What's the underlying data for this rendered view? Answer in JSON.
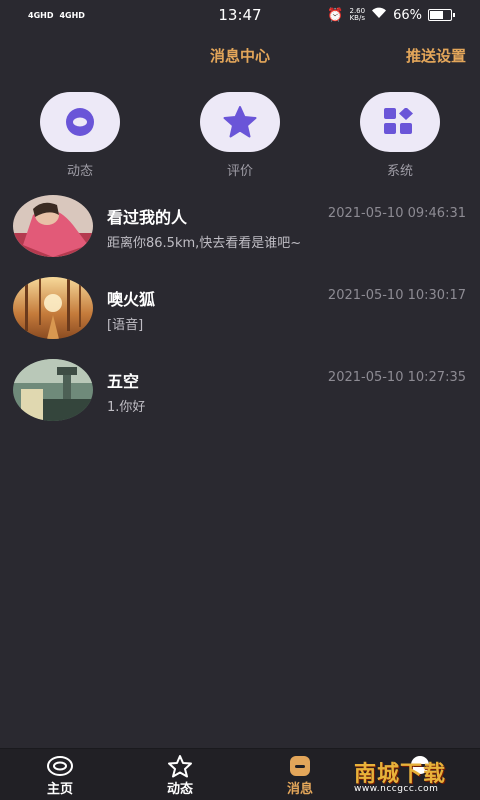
{
  "status_bar": {
    "network_1": "4GHD",
    "network_2": "4GHD",
    "time": "13:47",
    "speed_value": "2.60",
    "speed_unit": "KB/s",
    "battery": "66%",
    "battery_level": 0.66
  },
  "header": {
    "title": "消息中心",
    "action_label": "推送设置"
  },
  "categories": [
    {
      "label": "动态",
      "icon": "record-icon"
    },
    {
      "label": "评价",
      "icon": "star-icon"
    },
    {
      "label": "系统",
      "icon": "apps-icon"
    }
  ],
  "messages": [
    {
      "name": "看过我的人",
      "time": "2021-05-10 09:46:31",
      "preview": "距离你86.5km,快去看看是谁吧~"
    },
    {
      "name": "噢火狐",
      "time": "2021-05-10 10:30:17",
      "preview": "[语音]"
    },
    {
      "name": "五空",
      "time": "2021-05-10 10:27:35",
      "preview": "1.你好"
    }
  ],
  "bottom_nav": [
    {
      "label": "主页",
      "icon": "home-ring-icon"
    },
    {
      "label": "动态",
      "icon": "star-outline-icon"
    },
    {
      "label": "消息",
      "icon": "message-icon",
      "active": true
    },
    {
      "label": "",
      "icon": "profile-icon"
    }
  ],
  "watermark": {
    "main": "南城下载",
    "sub": "www.nccgcc.com"
  },
  "colors": {
    "background": "#2a2930",
    "accent": "#e3a65a",
    "icon_purple": "#6a55d8",
    "circle_bg": "#ede9f7"
  }
}
